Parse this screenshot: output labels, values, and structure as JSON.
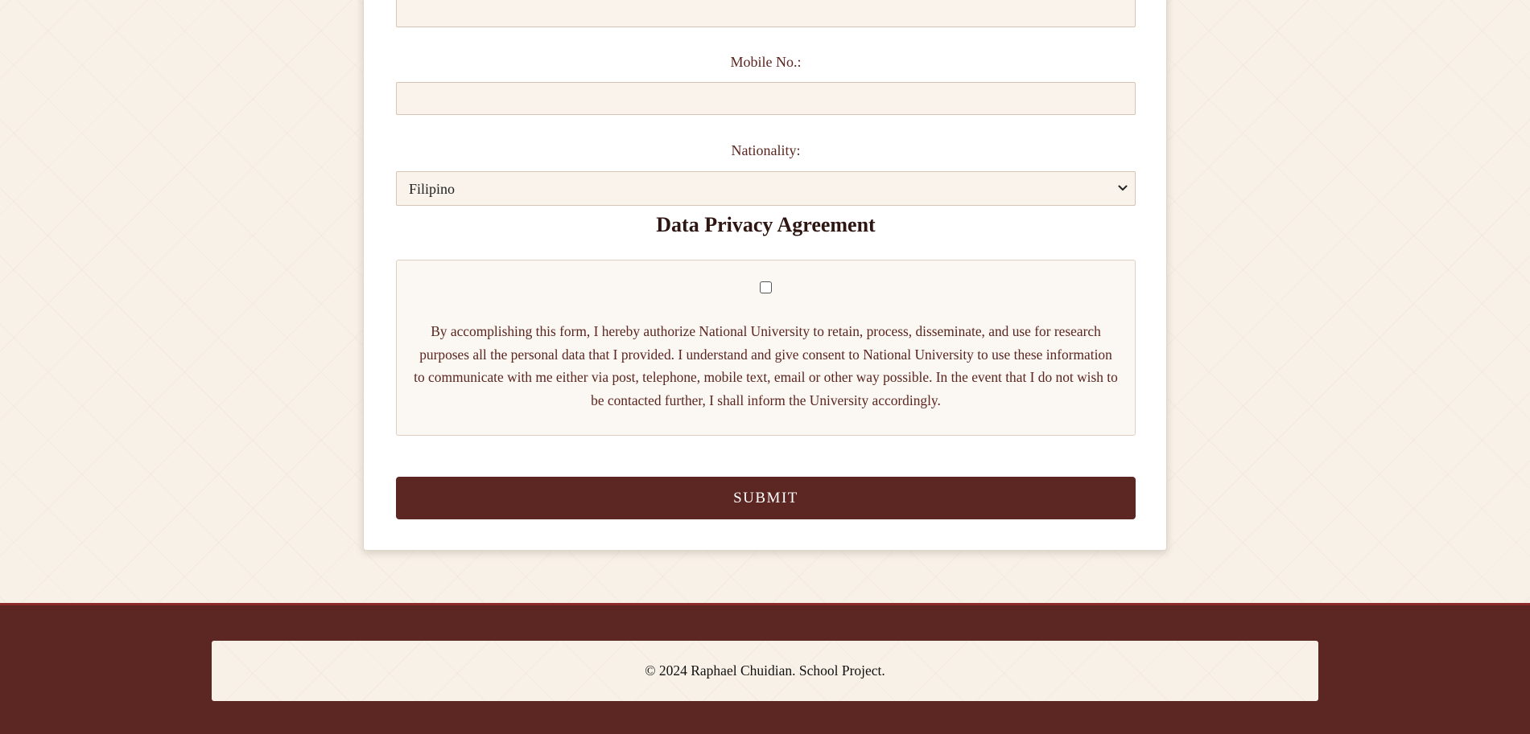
{
  "form": {
    "mobile_label": "Mobile No.:",
    "mobile_value": "",
    "nationality_label": "Nationality:",
    "nationality_selected": "Filipino"
  },
  "privacy": {
    "heading": "Data Privacy Agreement",
    "checked": false,
    "text": "By accomplishing this form, I hereby authorize National University to retain, process, disseminate, and use for research purposes all the personal data that I provided. I understand and give consent to National University to use these information to communicate with me either via post, telephone, mobile text, email or other way possible. In the event that I do not wish to be contacted further, I shall inform the University accordingly."
  },
  "submit_label": "SUBMIT",
  "footer": {
    "copyright": "© 2024 Raphael Chuidian. School Project."
  },
  "icons": {
    "select": "chevron-down-icon"
  },
  "colors": {
    "background": "#f8f1e7",
    "accent": "#5c2622",
    "text": "#5b2520",
    "input_bg": "#f9f3ec"
  }
}
